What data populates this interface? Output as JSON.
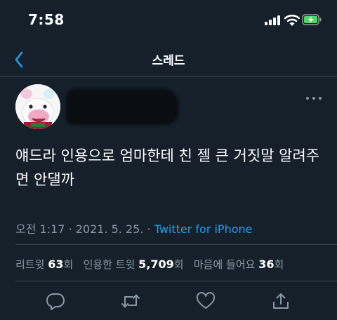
{
  "status_bar": {
    "time": "7:58"
  },
  "header": {
    "title": "스레드"
  },
  "tweet": {
    "text": "얘드라 인용으로 엄마한테 친 젤 큰 거짓말 알려주면 안댈까",
    "time": "오전 1:17",
    "date": "2021. 5. 25.",
    "source": "Twitter for iPhone"
  },
  "stats": {
    "retweets_label": "리트윗",
    "retweets": "63",
    "retweets_unit": "회",
    "quotes_label": "인용한 트윗",
    "quotes": "5,709",
    "quotes_unit": "회",
    "likes_label": "마음에 들어요",
    "likes": "36",
    "likes_unit": "회"
  },
  "icons": {
    "back": "chevron-left-icon",
    "more": "more-icon",
    "reply": "reply-icon",
    "retweet": "retweet-icon",
    "like": "heart-icon",
    "share": "share-icon"
  },
  "colors": {
    "background": "#15202b",
    "accent": "#1da1f2",
    "muted": "#8899a6",
    "battery": "#4cd964"
  }
}
